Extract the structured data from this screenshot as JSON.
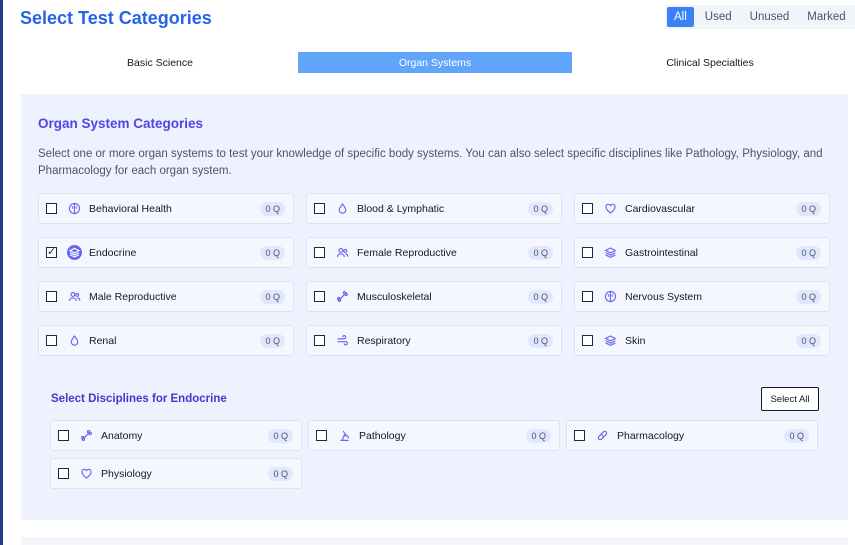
{
  "header": {
    "title": "Select Test Categories"
  },
  "filters": [
    "All",
    "Used",
    "Unused",
    "Marked"
  ],
  "tabs": [
    "Basic Science",
    "Organ Systems",
    "Clinical Specialties"
  ],
  "panel": {
    "title": "Organ System Categories",
    "description": "Select one or more organ systems to test your knowledge of specific body systems. You can also select specific disciplines like Pathology, Physiology, and Pharmacology for each organ system.",
    "categories": [
      {
        "label": "Behavioral Health",
        "count": "0 Q",
        "icon": "brain-icon",
        "checked": false
      },
      {
        "label": "Blood & Lymphatic",
        "count": "0 Q",
        "icon": "droplet-icon",
        "checked": false
      },
      {
        "label": "Cardiovascular",
        "count": "0 Q",
        "icon": "heart-icon",
        "checked": false
      },
      {
        "label": "Endocrine",
        "count": "0 Q",
        "icon": "layers-icon",
        "checked": true
      },
      {
        "label": "Female Reproductive",
        "count": "0 Q",
        "icon": "users-icon",
        "checked": false
      },
      {
        "label": "Gastrointestinal",
        "count": "0 Q",
        "icon": "layers-icon",
        "checked": false
      },
      {
        "label": "Male Reproductive",
        "count": "0 Q",
        "icon": "users-icon",
        "checked": false
      },
      {
        "label": "Musculoskeletal",
        "count": "0 Q",
        "icon": "bone-icon",
        "checked": false
      },
      {
        "label": "Nervous System",
        "count": "0 Q",
        "icon": "brain-icon",
        "checked": false
      },
      {
        "label": "Renal",
        "count": "0 Q",
        "icon": "droplet-icon",
        "checked": false
      },
      {
        "label": "Respiratory",
        "count": "0 Q",
        "icon": "wind-icon",
        "checked": false
      },
      {
        "label": "Skin",
        "count": "0 Q",
        "icon": "layers-icon",
        "checked": false
      }
    ]
  },
  "disciplines": {
    "title": "Select Disciplines for Endocrine",
    "select_all_label": "Select All",
    "items": [
      {
        "label": "Anatomy",
        "count": "0 Q",
        "icon": "bone-icon"
      },
      {
        "label": "Pathology",
        "count": "0 Q",
        "icon": "microscope-icon"
      },
      {
        "label": "Pharmacology",
        "count": "0 Q",
        "icon": "pill-icon"
      },
      {
        "label": "Physiology",
        "count": "0 Q",
        "icon": "heart-icon"
      }
    ]
  },
  "colors": {
    "accent": "#2563eb",
    "tab_active": "#60a5fa",
    "filter_active": "#3b82f6",
    "panel_bg": "#eef2ff",
    "heading": "#4f46e5"
  }
}
